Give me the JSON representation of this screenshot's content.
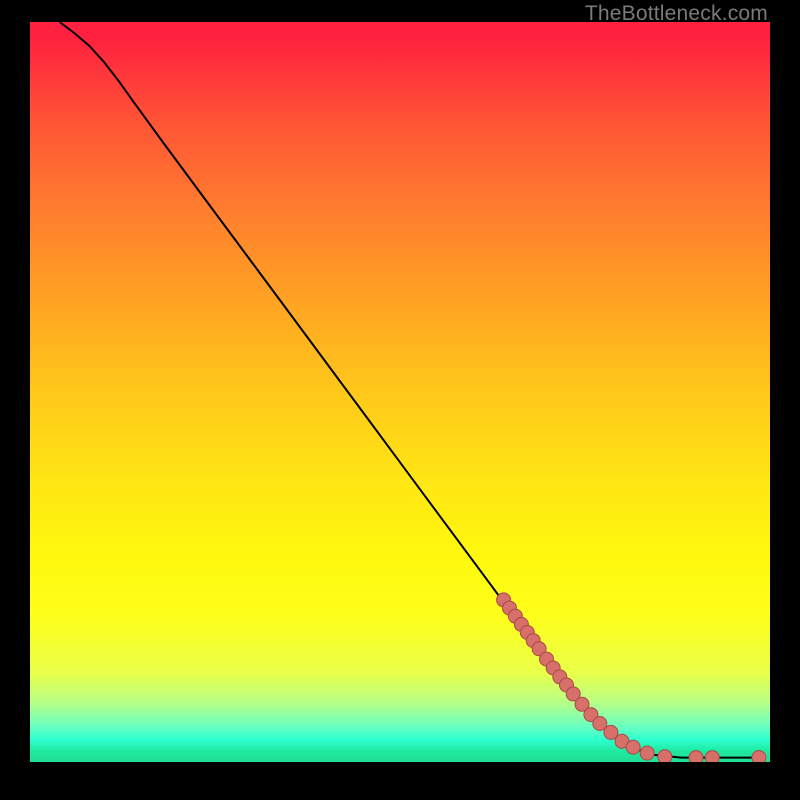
{
  "watermark": "TheBottleneck.com",
  "colors": {
    "marker_fill": "#d76f6b",
    "marker_stroke": "#a94a47",
    "curve": "#000000"
  },
  "chart_data": {
    "type": "line",
    "title": "",
    "xlabel": "",
    "ylabel": "",
    "xlim": [
      0,
      100
    ],
    "ylim": [
      0,
      100
    ],
    "curve": [
      {
        "x": 4.0,
        "y": 100.0
      },
      {
        "x": 6.0,
        "y": 98.5
      },
      {
        "x": 8.0,
        "y": 96.8
      },
      {
        "x": 10.0,
        "y": 94.6
      },
      {
        "x": 12.0,
        "y": 92.0
      },
      {
        "x": 14.0,
        "y": 89.2
      },
      {
        "x": 18.0,
        "y": 83.7
      },
      {
        "x": 24.0,
        "y": 75.6
      },
      {
        "x": 30.0,
        "y": 67.5
      },
      {
        "x": 36.0,
        "y": 59.4
      },
      {
        "x": 42.0,
        "y": 51.3
      },
      {
        "x": 48.0,
        "y": 43.2
      },
      {
        "x": 54.0,
        "y": 35.1
      },
      {
        "x": 60.0,
        "y": 27.0
      },
      {
        "x": 66.0,
        "y": 18.9
      },
      {
        "x": 70.0,
        "y": 13.5
      },
      {
        "x": 74.0,
        "y": 8.5
      },
      {
        "x": 78.0,
        "y": 4.4
      },
      {
        "x": 81.0,
        "y": 2.1
      },
      {
        "x": 84.0,
        "y": 1.0
      },
      {
        "x": 88.0,
        "y": 0.6
      },
      {
        "x": 92.0,
        "y": 0.6
      },
      {
        "x": 96.0,
        "y": 0.6
      },
      {
        "x": 99.0,
        "y": 0.6
      }
    ],
    "markers": [
      {
        "x": 64.0,
        "y": 21.9
      },
      {
        "x": 64.8,
        "y": 20.8
      },
      {
        "x": 65.6,
        "y": 19.7
      },
      {
        "x": 66.4,
        "y": 18.6
      },
      {
        "x": 67.2,
        "y": 17.5
      },
      {
        "x": 68.0,
        "y": 16.4
      },
      {
        "x": 68.8,
        "y": 15.3
      },
      {
        "x": 69.8,
        "y": 13.9
      },
      {
        "x": 70.7,
        "y": 12.7
      },
      {
        "x": 71.6,
        "y": 11.5
      },
      {
        "x": 72.5,
        "y": 10.4
      },
      {
        "x": 73.4,
        "y": 9.2
      },
      {
        "x": 74.6,
        "y": 7.8
      },
      {
        "x": 75.8,
        "y": 6.4
      },
      {
        "x": 77.0,
        "y": 5.2
      },
      {
        "x": 78.5,
        "y": 4.0
      },
      {
        "x": 80.0,
        "y": 2.8
      },
      {
        "x": 81.5,
        "y": 2.0
      },
      {
        "x": 83.4,
        "y": 1.2
      },
      {
        "x": 85.8,
        "y": 0.7
      },
      {
        "x": 90.0,
        "y": 0.6
      },
      {
        "x": 92.2,
        "y": 0.6
      },
      {
        "x": 98.5,
        "y": 0.6
      }
    ]
  }
}
